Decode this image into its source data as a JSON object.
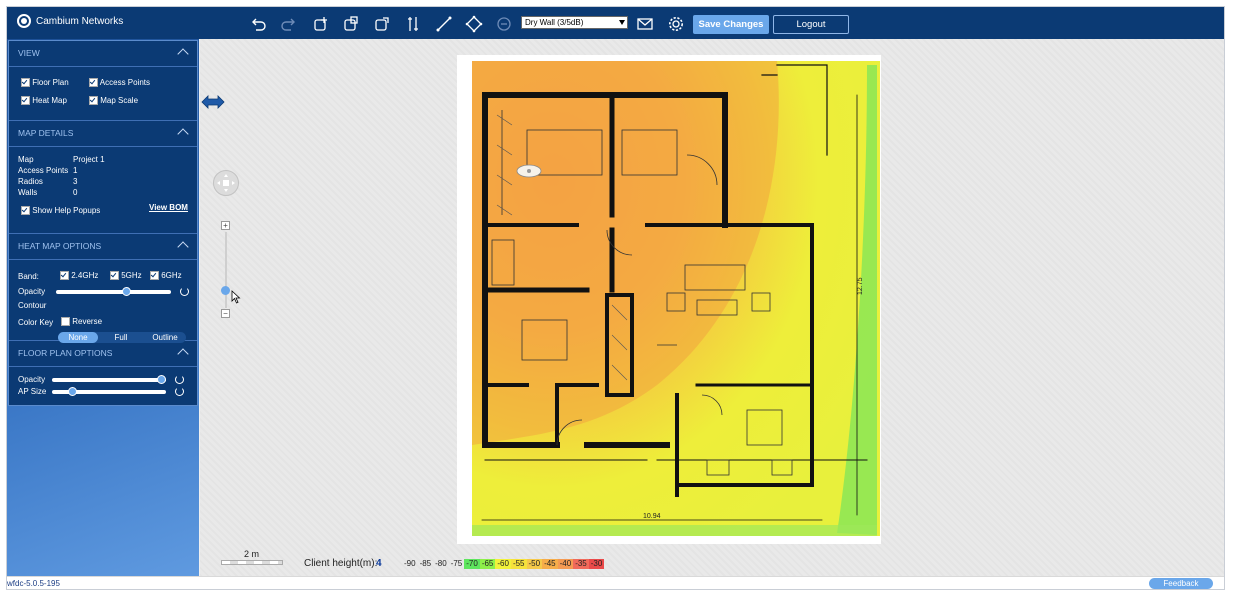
{
  "app": {
    "brand": "Cambium Networks",
    "version": "wfdc-5.0.5-195",
    "feedback": "Feedback"
  },
  "toolbar": {
    "icons": [
      "undo-icon",
      "redo-icon",
      "add-ap-icon",
      "copy-ap-icon",
      "move-ap-icon",
      "measure-icon",
      "draw-wall-icon",
      "edit-wall-icon",
      "delete-icon",
      "email-icon",
      "gear-icon"
    ],
    "wall_type": "Dry Wall (3/5dB)",
    "save_label": "Save Changes",
    "logout_label": "Logout"
  },
  "sidebar": {
    "view": {
      "title": "VIEW",
      "items": [
        {
          "label": "Floor Plan",
          "checked": true
        },
        {
          "label": "Access Points",
          "checked": true
        },
        {
          "label": "Heat Map",
          "checked": true
        },
        {
          "label": "Map Scale",
          "checked": true
        }
      ]
    },
    "map_details": {
      "title": "MAP DETAILS",
      "rows": [
        {
          "label": "Map",
          "value": "Project 1"
        },
        {
          "label": "Access Points",
          "value": "1"
        },
        {
          "label": "Radios",
          "value": "3"
        },
        {
          "label": "Walls",
          "value": "0"
        }
      ],
      "help_popups": "Show Help Popups",
      "view_bom": "View BOM"
    },
    "heat_map_options": {
      "title": "HEAT MAP OPTIONS",
      "band_label": "Band:",
      "bands": [
        "2.4GHz",
        "5GHz",
        "6GHz"
      ],
      "opacity_label": "Opacity",
      "opacity_value": 0.62,
      "contour_label": "Contour",
      "contour_options": [
        "None",
        "Full",
        "Outline"
      ],
      "contour_selected": "None",
      "colour_key_label": "Color Key",
      "reverse_label": "Reverse"
    },
    "floor_plan_options": {
      "title": "FLOOR PLAN OPTIONS",
      "opacity_label": "Opacity",
      "opacity_value": 1.0,
      "ap_size_label": "AP Size",
      "ap_size_value": 0.15
    }
  },
  "canvas": {
    "dim_width": "10.94",
    "dim_height": "12.75",
    "scale_label": "2 m",
    "client_height_label": "Client height(m):",
    "client_height_value": "4",
    "legend": [
      {
        "label": "-90",
        "color": ""
      },
      {
        "label": "-85",
        "color": ""
      },
      {
        "label": "-80",
        "color": ""
      },
      {
        "label": "-75",
        "color": ""
      },
      {
        "label": "-70",
        "color": "#5ee65e"
      },
      {
        "label": "-65",
        "color": "#8ef04a"
      },
      {
        "label": "-60",
        "color": "#f2f23a"
      },
      {
        "label": "-55",
        "color": "#f6e23c"
      },
      {
        "label": "-50",
        "color": "#f6c94a"
      },
      {
        "label": "-45",
        "color": "#f6ad4a"
      },
      {
        "label": "-40",
        "color": "#f59a52"
      },
      {
        "label": "-35",
        "color": "#f06a5a"
      },
      {
        "label": "-30",
        "color": "#ea4a4a"
      }
    ]
  }
}
